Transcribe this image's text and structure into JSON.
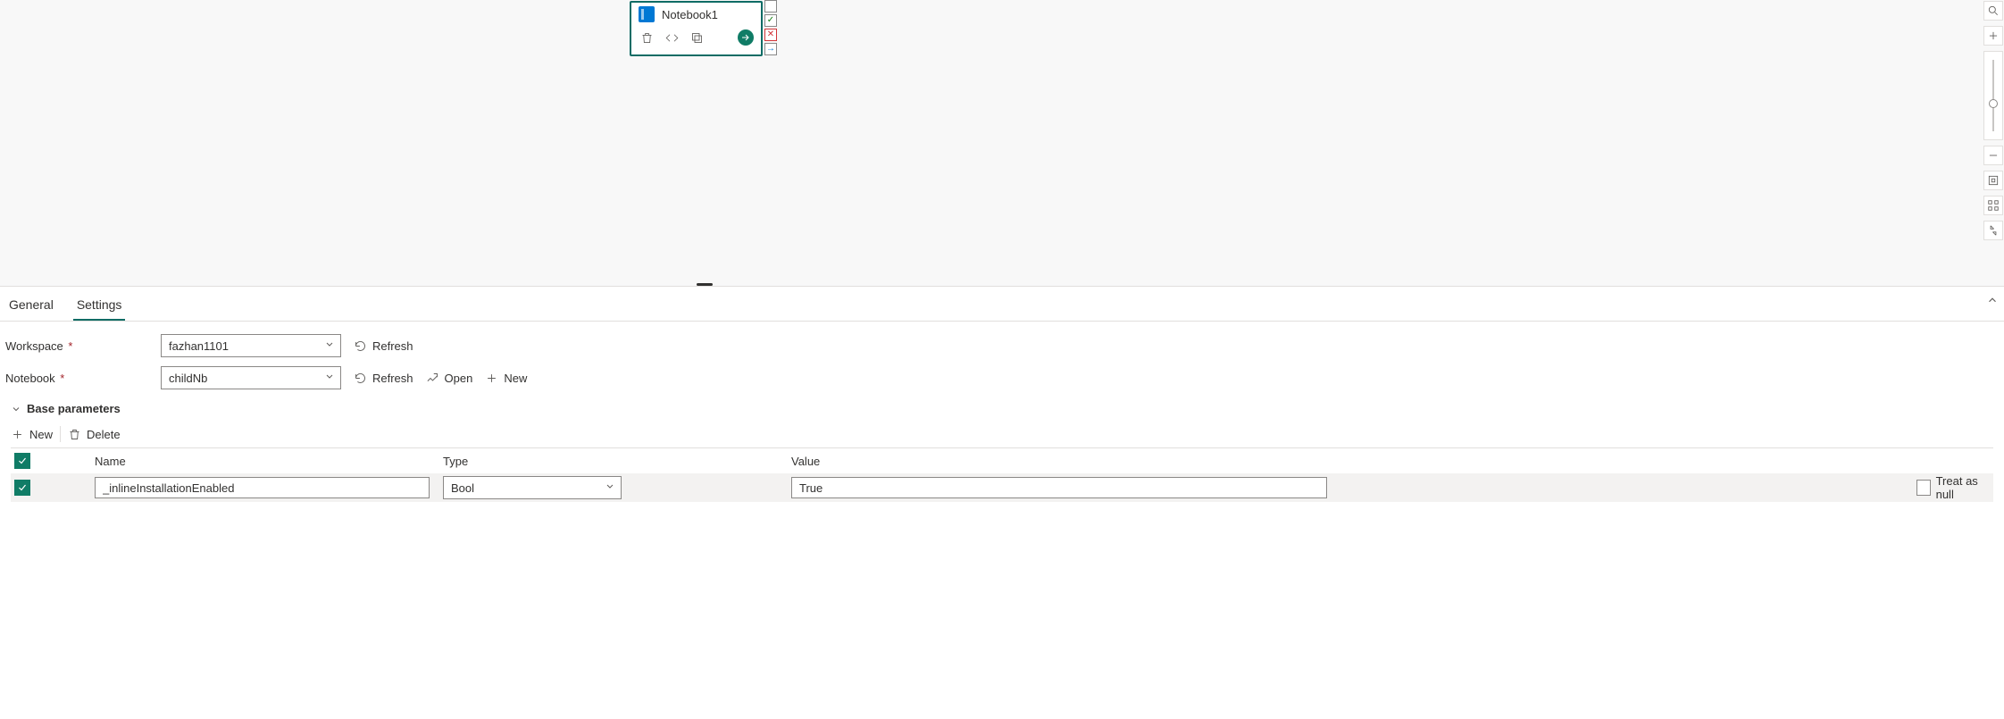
{
  "node": {
    "title": "Notebook1"
  },
  "icons": {
    "trash": "trash-icon",
    "code": "code-icon",
    "copy": "copy-icon",
    "run": "run-icon",
    "status_ok": "status-ok-icon",
    "status_err": "status-err-icon",
    "status_go": "status-go-icon"
  },
  "rail": {
    "search": "search",
    "zoom_in": "+",
    "zoom_out": "−",
    "fit": "fit-to-screen",
    "layout": "auto-layout",
    "collapse": "collapse"
  },
  "tabs": {
    "general": "General",
    "settings": "Settings",
    "active": "settings"
  },
  "form": {
    "workspace_label": "Workspace",
    "workspace_value": "fazhan1101",
    "notebook_label": "Notebook",
    "notebook_value": "childNb",
    "refresh": "Refresh",
    "open": "Open",
    "new": "New"
  },
  "section": {
    "base_parameters": "Base parameters"
  },
  "param_toolbar": {
    "new": "New",
    "delete": "Delete"
  },
  "param_table": {
    "headers": {
      "name": "Name",
      "type": "Type",
      "value": "Value"
    },
    "rows": [
      {
        "checked": true,
        "name": "_inlineInstallationEnabled",
        "type": "Bool",
        "value": "True",
        "treat_as_null": false
      }
    ],
    "treat_as_null_label": "Treat as null"
  }
}
